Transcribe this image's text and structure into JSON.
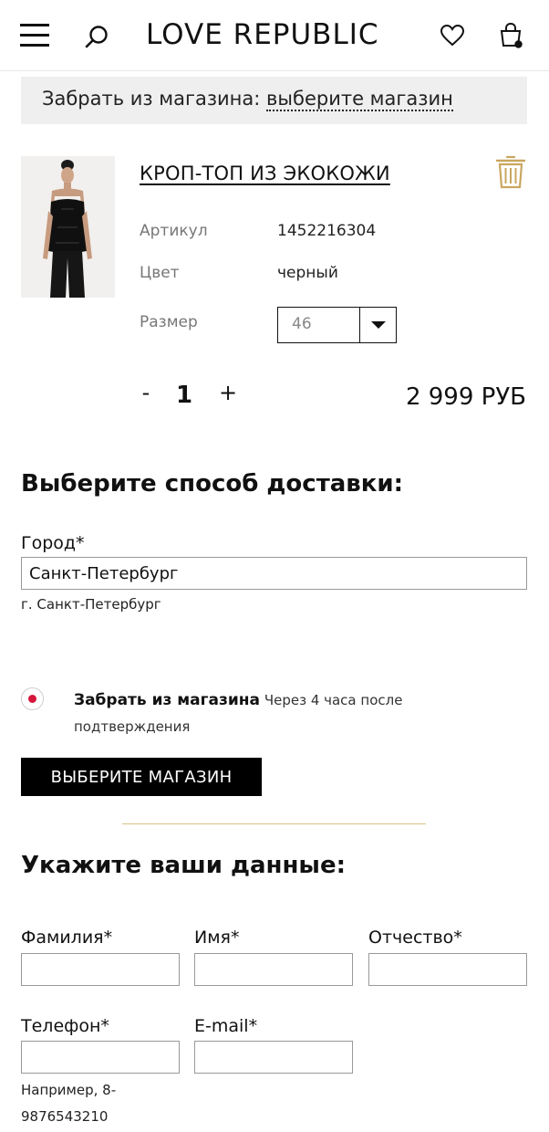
{
  "header": {
    "logo": "LOVE REPUBLIC"
  },
  "pickup_bar": {
    "prefix": "Забрать из магазина:",
    "link": "выберите магазин"
  },
  "product": {
    "title": "КРОП-ТОП ИЗ ЭКОКОЖИ",
    "article_label": "Артикул",
    "article_value": "1452216304",
    "color_label": "Цвет",
    "color_value": "черный",
    "size_label": "Размер",
    "size_value": "46",
    "qty_minus": "-",
    "qty_value": "1",
    "qty_plus": "+",
    "price": "2 999 РУБ"
  },
  "delivery": {
    "heading": "Выберите способ доставки:",
    "city_label": "Город*",
    "city_value": "Санкт-Петербург",
    "city_hint": "г. Санкт-Петербург",
    "option_title": "Забрать из магазина",
    "option_desc": "Через 4 часа после подтверждения",
    "store_button": "ВЫБЕРИТЕ МАГАЗИН"
  },
  "contacts": {
    "heading": "Укажите ваши данные:",
    "surname_label": "Фамилия*",
    "name_label": "Имя*",
    "patronymic_label": "Отчество*",
    "phone_label": "Телефон*",
    "email_label": "E-mail*",
    "phone_hint": "Например, 8-9876543210"
  },
  "colors": {
    "accent_divider": "#d9c286",
    "radio_dot": "#d6163a",
    "trash": "#c9a760"
  }
}
